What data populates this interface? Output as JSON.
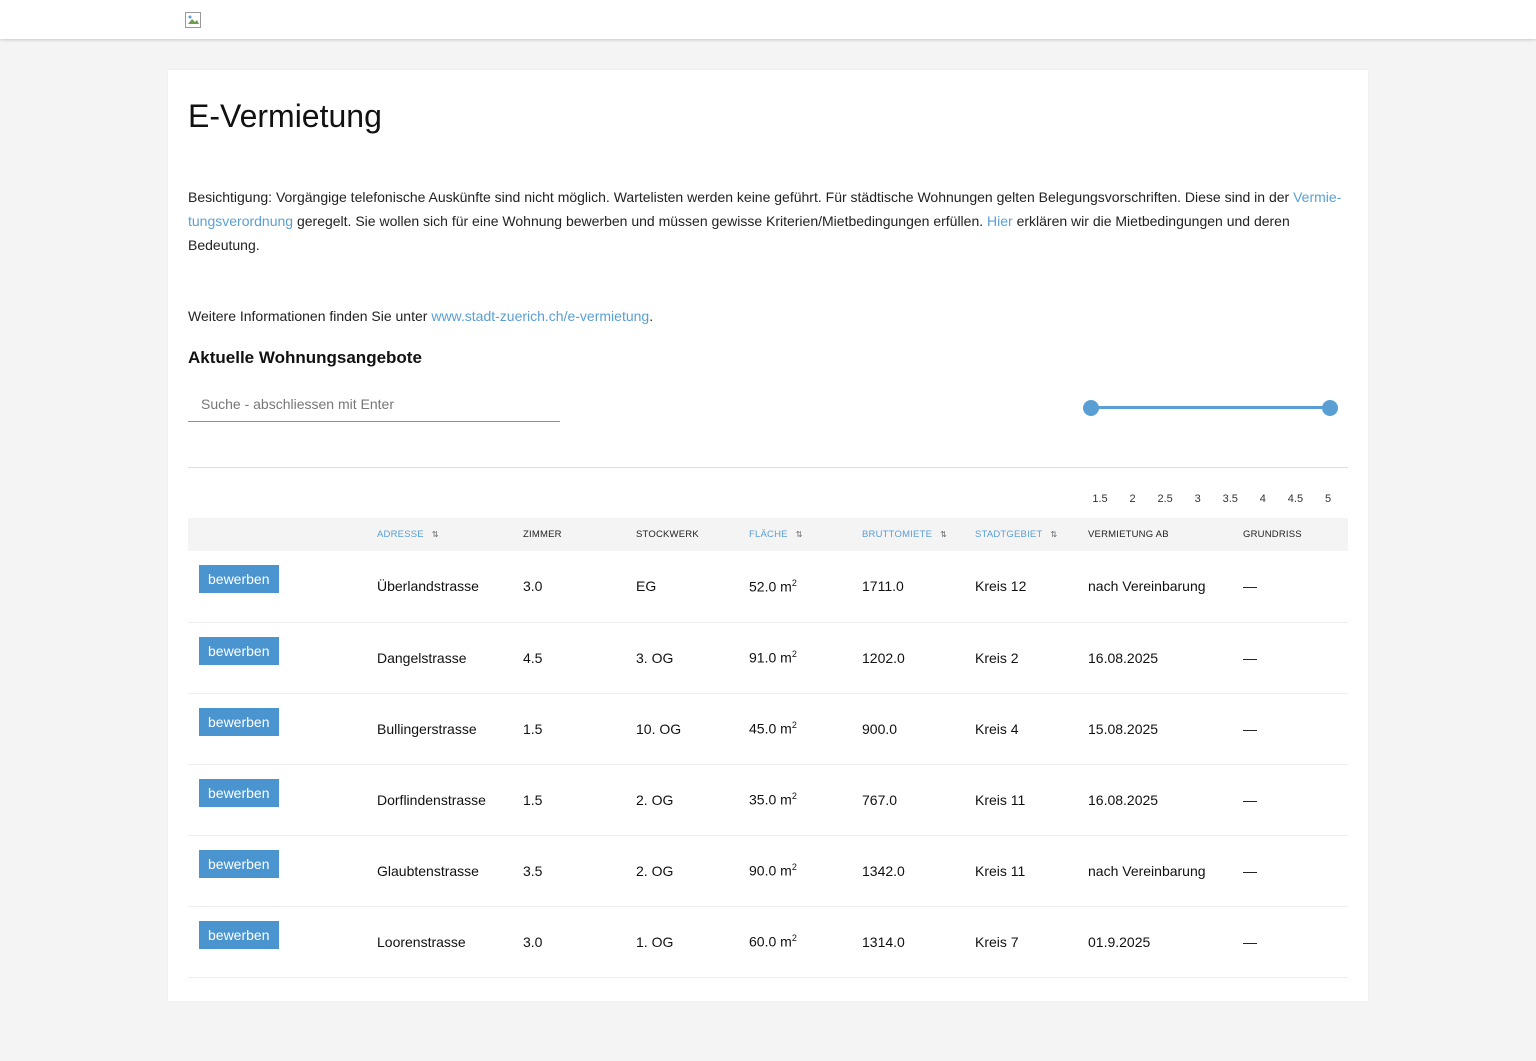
{
  "header": {
    "logo_alt": "logo"
  },
  "page": {
    "title": "E-Vermietung",
    "intro": {
      "part1": "Besichtigung: Vorgängige telefonische Auskünfte sind nicht möglich. Wartelisten werden keine geführt. Für städtische Wohnungen gelten Belegungsvorschriften. Diese sind in der ",
      "link1": "Vermie­tungsverordnung",
      "part2": " geregelt. Sie wollen sich für eine Wohnung bewerben und müssen gewisse Kriterien/Mietbedingungen erfüllen. ",
      "link2": "Hier",
      "part3": " erklären wir die Mietbedingungen und deren Bedeutung."
    },
    "more": {
      "prefix": "Weitere Informationen finden Sie unter ",
      "link": "www.stadt-zuerich.ch/e-vermietung",
      "suffix": "."
    },
    "subhead": "Aktuelle Wohnungsangebote"
  },
  "search": {
    "placeholder": "Suche - abschliessen mit Enter"
  },
  "slider": {
    "min": 1.5,
    "max": 5,
    "selected_min": 1.5,
    "selected_max": 5,
    "ticks": [
      "1.5",
      "2",
      "2.5",
      "3",
      "3.5",
      "4",
      "4.5",
      "5"
    ]
  },
  "colors": {
    "accent": "#5a9fd4",
    "button": "#4a94d0",
    "background": "#f4f4f4"
  },
  "table": {
    "headers": {
      "adresse": "Adresse",
      "zimmer": "Zimmer",
      "stockwerk": "Stockwerk",
      "flaeche": "Fläche",
      "bruttomiete": "Bruttomiete",
      "stadtgebiet": "Stadtgebiet",
      "vermietung_ab": "Vermietung ab",
      "grundriss": "Grundriss"
    },
    "sort_icon": "sort-icon",
    "button_label": "bewerben",
    "area_unit": "m",
    "area_exp": "2",
    "rows": [
      {
        "adresse": "Überlandstrasse",
        "zimmer": "3.0",
        "stockwerk": "EG",
        "flaeche": "52.0",
        "miete": "1711.0",
        "gebiet": "Kreis 12",
        "ab": "nach Vereinbarung",
        "grundriss": "—"
      },
      {
        "adresse": "Dangelstrasse",
        "zimmer": "4.5",
        "stockwerk": "3. OG",
        "flaeche": "91.0",
        "miete": "1202.0",
        "gebiet": "Kreis 2",
        "ab": "16.08.2025",
        "grundriss": "—"
      },
      {
        "adresse": "Bullingerstrasse",
        "zimmer": "1.5",
        "stockwerk": "10. OG",
        "flaeche": "45.0",
        "miete": "900.0",
        "gebiet": "Kreis 4",
        "ab": "15.08.2025",
        "grundriss": "—"
      },
      {
        "adresse": "Dorflindenstrasse",
        "zimmer": "1.5",
        "stockwerk": "2. OG",
        "flaeche": "35.0",
        "miete": "767.0",
        "gebiet": "Kreis 11",
        "ab": "16.08.2025",
        "grundriss": "—"
      },
      {
        "adresse": "Glaubtenstrasse",
        "zimmer": "3.5",
        "stockwerk": "2. OG",
        "flaeche": "90.0",
        "miete": "1342.0",
        "gebiet": "Kreis 11",
        "ab": "nach Vereinbarung",
        "grundriss": "—"
      },
      {
        "adresse": "Loorenstrasse",
        "zimmer": "3.0",
        "stockwerk": "1. OG",
        "flaeche": "60.0",
        "miete": "1314.0",
        "gebiet": "Kreis 7",
        "ab": "01.9.2025",
        "grundriss": "—"
      }
    ]
  }
}
